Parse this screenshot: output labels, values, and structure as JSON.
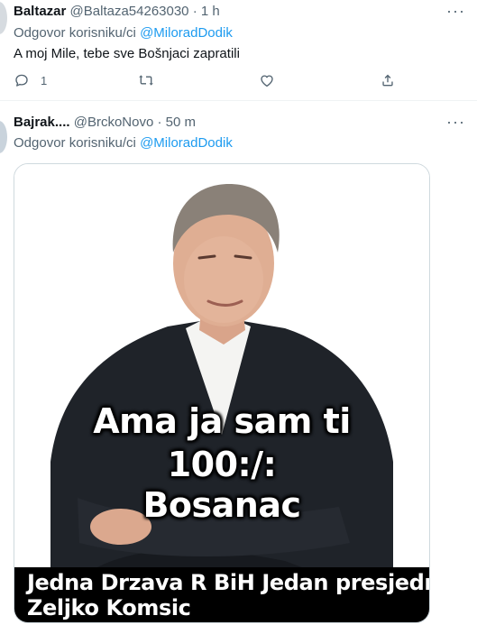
{
  "tweets": [
    {
      "display_name": "Baltazar",
      "handle": "@Baltaza54263030",
      "separator": "·",
      "time": "1 h",
      "reply_prefix": "Odgovor korisniku/ci",
      "reply_to": "@MiloradDodik",
      "text": "A moj Mile, tebe sve Bošnjaci zapratili",
      "reply_count": "1",
      "more_icon": "more-icon",
      "icons": [
        "reply-icon",
        "retweet-icon",
        "like-icon",
        "share-icon"
      ]
    },
    {
      "display_name": "Bajrak....",
      "handle": "@BrckoNovo",
      "separator": "·",
      "time": "50 m",
      "reply_prefix": "Odgovor korisniku/ci",
      "reply_to": "@MiloradDodik",
      "media": {
        "overlay_lines": [
          "Ama ja sam ti",
          "100:/:",
          "Bosanac"
        ],
        "caption_lines": [
          "Jedna Drzava R BiH Jedan presjednik",
          "Zeljko Komsic"
        ]
      }
    }
  ],
  "colors": {
    "accent": "#1d9bf0",
    "muted": "#536471",
    "text": "#0f1419",
    "divider": "#eff3f4"
  }
}
